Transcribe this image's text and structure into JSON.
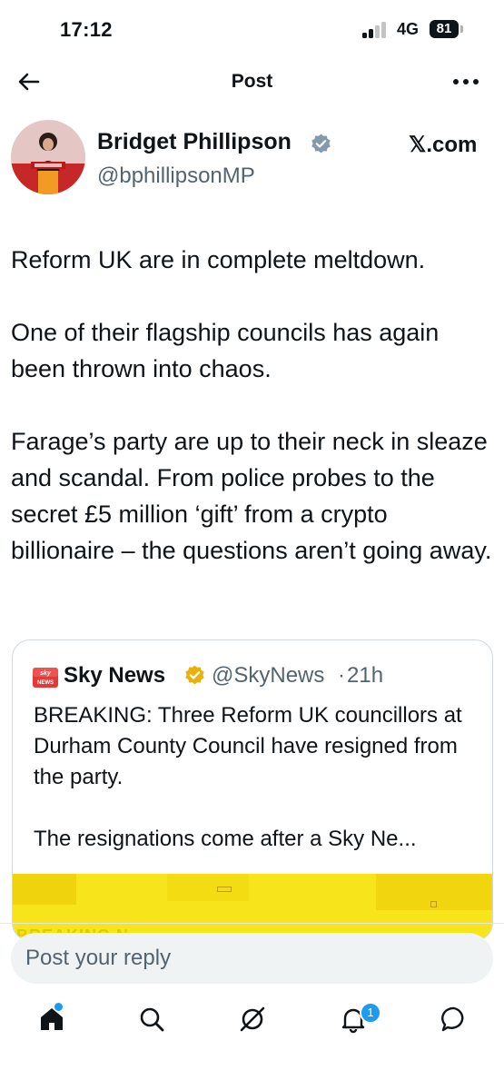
{
  "status_bar": {
    "time": "17:12",
    "network": "4G",
    "battery": "81"
  },
  "header": {
    "title": "Post"
  },
  "author": {
    "name": "Bridget Phillipson",
    "handle": "@bphillipsonMP",
    "source": "𝕏.com"
  },
  "tweet": {
    "paragraphs": [
      "Reform UK are in complete meltdown.",
      "One of their flagship councils has again been thrown into chaos.",
      "Farage’s party are up to their neck in sleaze and scandal. From police probes to the secret £5 million ‘gift’ from a crypto billionaire – the questions aren’t going away."
    ]
  },
  "quote": {
    "name": "Sky News",
    "handle": "@SkyNews",
    "separator": "·",
    "time": "21h",
    "paragraphs": [
      "BREAKING: Three Reform UK councillors at Durham County Council have resigned from the party.",
      "The resignations come after a Sky Ne..."
    ],
    "media_text": "BREAKING N"
  },
  "reply": {
    "placeholder": "Post your reply"
  },
  "tabbar": {
    "tabs": [
      "home-icon",
      "search-icon",
      "grok-icon",
      "notifications-icon",
      "messages-icon"
    ],
    "notifications_badge": "1"
  },
  "colors": {
    "accent": "#1d9bf0",
    "secondary_text": "#536471",
    "media_yellow": "#f7e41a"
  }
}
